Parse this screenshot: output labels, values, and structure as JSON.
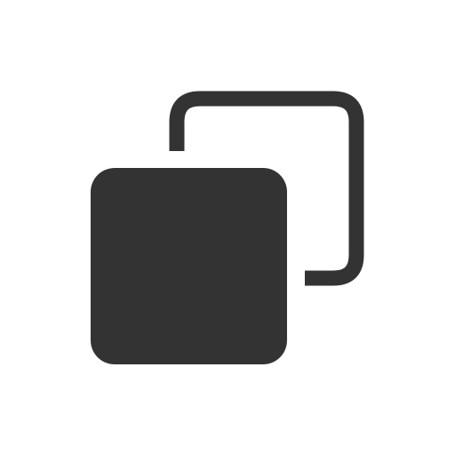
{
  "icon": {
    "name": "copy-icon",
    "color": "#333333",
    "background": "#ffffff"
  }
}
